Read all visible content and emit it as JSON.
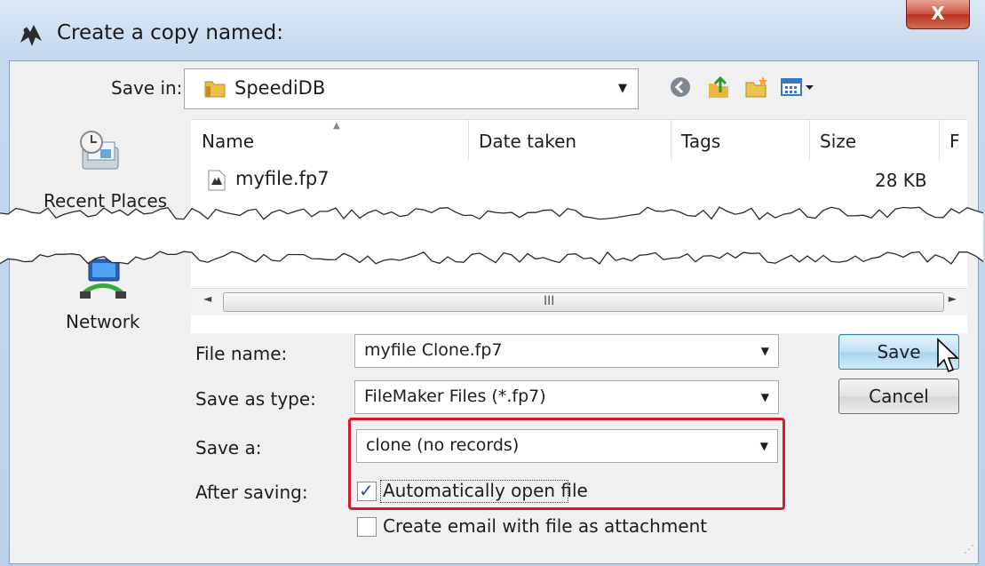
{
  "window": {
    "title": "Create a copy named:",
    "close_label": "X"
  },
  "save_in": {
    "label": "Save in:",
    "folder": "SpeediDB"
  },
  "toolbar": {
    "icons": [
      "back-icon",
      "up-folder-icon",
      "new-folder-icon",
      "view-menu-icon"
    ]
  },
  "places": {
    "items": [
      {
        "label": "Recent Places",
        "icon": "recent-places-icon"
      },
      {
        "label": "Network",
        "icon": "network-icon"
      }
    ]
  },
  "file_list": {
    "columns": [
      "Name",
      "Date taken",
      "Tags",
      "Size",
      "F"
    ],
    "rows": [
      {
        "name": "myfile.fp7",
        "size": "28 KB"
      }
    ],
    "scroll_grip": "III"
  },
  "form": {
    "file_name_label": "File name:",
    "file_name_value": "myfile Clone.fp7",
    "save_as_type_label": "Save as type:",
    "save_as_type_value": "FileMaker Files (*.fp7)",
    "save_a_label": "Save a:",
    "save_a_value": "clone (no records)",
    "after_saving_label": "After saving:",
    "auto_open_label": "Automatically open file",
    "auto_open_checked": true,
    "email_label": "Create email with file as attachment",
    "email_checked": false
  },
  "buttons": {
    "save": "Save",
    "cancel": "Cancel"
  },
  "colors": {
    "highlight_box": "#d8192b",
    "title_bar": "#c6d9ee",
    "close_button": "#c8533d"
  }
}
